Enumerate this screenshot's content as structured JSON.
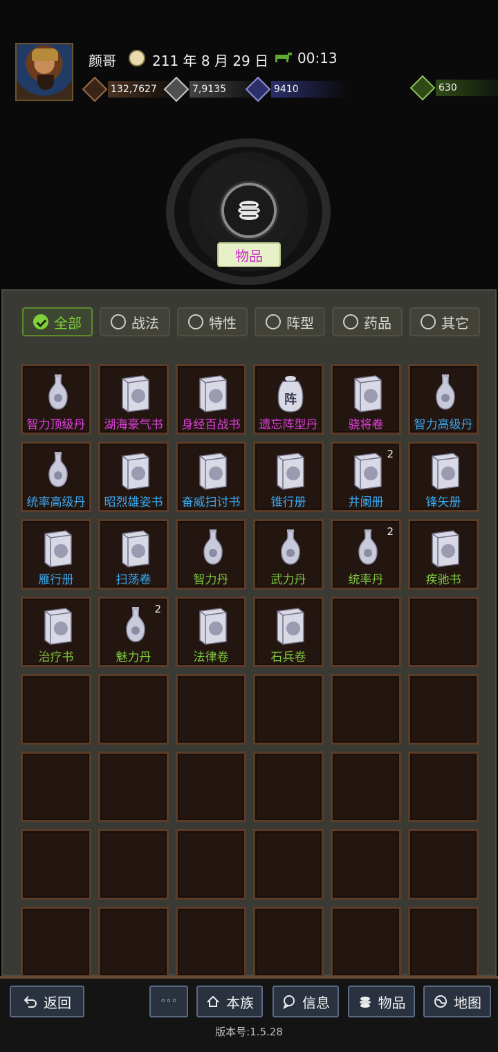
{
  "header": {
    "player_name": "颜哥",
    "date": "211 年 8 月 29 日",
    "time": "00:13",
    "resources": {
      "money": "132,7627",
      "food": "7,9135",
      "troops": "9410",
      "jade": "630"
    }
  },
  "category": {
    "label": "物品"
  },
  "filters": [
    {
      "label": "全部",
      "active": true
    },
    {
      "label": "战法",
      "active": false
    },
    {
      "label": "特性",
      "active": false
    },
    {
      "label": "阵型",
      "active": false
    },
    {
      "label": "药品",
      "active": false
    },
    {
      "label": "其它",
      "active": false
    }
  ],
  "items": [
    {
      "name": "智力顶级丹",
      "icon": "vase-icon",
      "color": "purple",
      "count": ""
    },
    {
      "name": "湖海豪气书",
      "icon": "book-icon",
      "color": "purple",
      "count": ""
    },
    {
      "name": "身经百战书",
      "icon": "book-icon",
      "color": "purple",
      "count": ""
    },
    {
      "name": "遗忘阵型丹",
      "icon": "jar-icon",
      "color": "purple",
      "count": ""
    },
    {
      "name": "骁将卷",
      "icon": "book-icon",
      "color": "purple",
      "count": ""
    },
    {
      "name": "智力高级丹",
      "icon": "vase-icon",
      "color": "blue",
      "count": ""
    },
    {
      "name": "统率高级丹",
      "icon": "vase-icon",
      "color": "blue",
      "count": ""
    },
    {
      "name": "昭烈雄姿书",
      "icon": "book-icon",
      "color": "blue",
      "count": ""
    },
    {
      "name": "奋威扫讨书",
      "icon": "book-icon",
      "color": "blue",
      "count": ""
    },
    {
      "name": "锥行册",
      "icon": "book-icon",
      "color": "blue",
      "count": ""
    },
    {
      "name": "井阑册",
      "icon": "book-icon",
      "color": "blue",
      "count": "2"
    },
    {
      "name": "锋矢册",
      "icon": "book-icon",
      "color": "blue",
      "count": ""
    },
    {
      "name": "雁行册",
      "icon": "book-icon",
      "color": "blue",
      "count": ""
    },
    {
      "name": "扫荡卷",
      "icon": "book-icon",
      "color": "blue",
      "count": ""
    },
    {
      "name": "智力丹",
      "icon": "vase-icon",
      "color": "green",
      "count": ""
    },
    {
      "name": "武力丹",
      "icon": "vase-icon",
      "color": "green",
      "count": ""
    },
    {
      "name": "统率丹",
      "icon": "vase-icon",
      "color": "green",
      "count": "2"
    },
    {
      "name": "疾驰书",
      "icon": "book-icon",
      "color": "green",
      "count": ""
    },
    {
      "name": "治疗书",
      "icon": "book-icon",
      "color": "green",
      "count": ""
    },
    {
      "name": "魅力丹",
      "icon": "vase-icon",
      "color": "green",
      "count": "2"
    },
    {
      "name": "法律卷",
      "icon": "book-icon",
      "color": "green",
      "count": ""
    },
    {
      "name": "石兵卷",
      "icon": "book-icon",
      "color": "green",
      "count": ""
    }
  ],
  "jar_glyph": "阵",
  "nav": {
    "back": "返回",
    "more": "◦◦◦",
    "clan": "本族",
    "info": "信息",
    "items": "物品",
    "map": "地图"
  },
  "version": "版本号:1.5.28"
}
